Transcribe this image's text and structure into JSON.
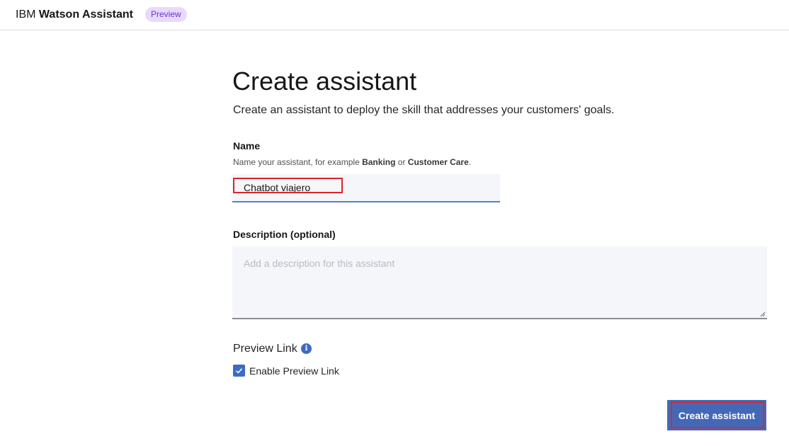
{
  "header": {
    "brand_prefix": "IBM",
    "brand_name": "Watson Assistant",
    "badge": "Preview"
  },
  "main": {
    "title": "Create assistant",
    "subtitle": "Create an assistant to deploy the skill that addresses your customers' goals.",
    "name_field": {
      "label": "Name",
      "helper_prefix": "Name your assistant, for example",
      "helper_example_1": "Banking",
      "helper_or": "or",
      "helper_example_2": "Customer Care",
      "helper_suffix": ".",
      "value": "Chatbot viajero"
    },
    "description_field": {
      "label": "Description (optional)",
      "placeholder": "Add a description for this assistant"
    },
    "preview_link": {
      "heading": "Preview Link",
      "info_icon": "info-icon",
      "checkbox_label": "Enable Preview Link",
      "checked": true
    },
    "create_button_label": "Create assistant"
  },
  "colors": {
    "accent": "#3d6bc4",
    "button": "#4468b8",
    "highlight": "#d9272e",
    "badge_bg": "#e8daff",
    "badge_text": "#6e32c9",
    "field_bg": "#f4f6fa"
  }
}
